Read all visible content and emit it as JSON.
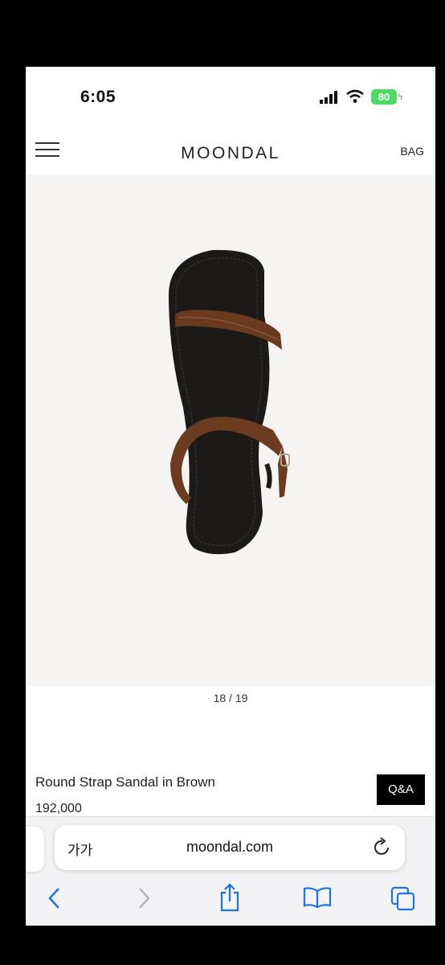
{
  "status_bar": {
    "time": "6:05",
    "battery": "80"
  },
  "header": {
    "logo": "MOONDAL",
    "bag_label": "BAG"
  },
  "gallery": {
    "counter": "18 / 19"
  },
  "product": {
    "name": "Round Strap Sandal in Brown",
    "price": "192,000",
    "qa_label": "Q&A"
  },
  "browser": {
    "text_size_label": "가가",
    "domain": "moondal.com"
  },
  "icons": [
    "menu-icon",
    "signal-icon",
    "wifi-icon",
    "battery-icon",
    "reload-icon",
    "back-icon",
    "forward-icon",
    "share-icon",
    "bookmarks-icon",
    "tabs-icon"
  ],
  "colors": {
    "accent": "#1a73e8",
    "button_bg": "#000000",
    "battery": "#4cd964"
  }
}
